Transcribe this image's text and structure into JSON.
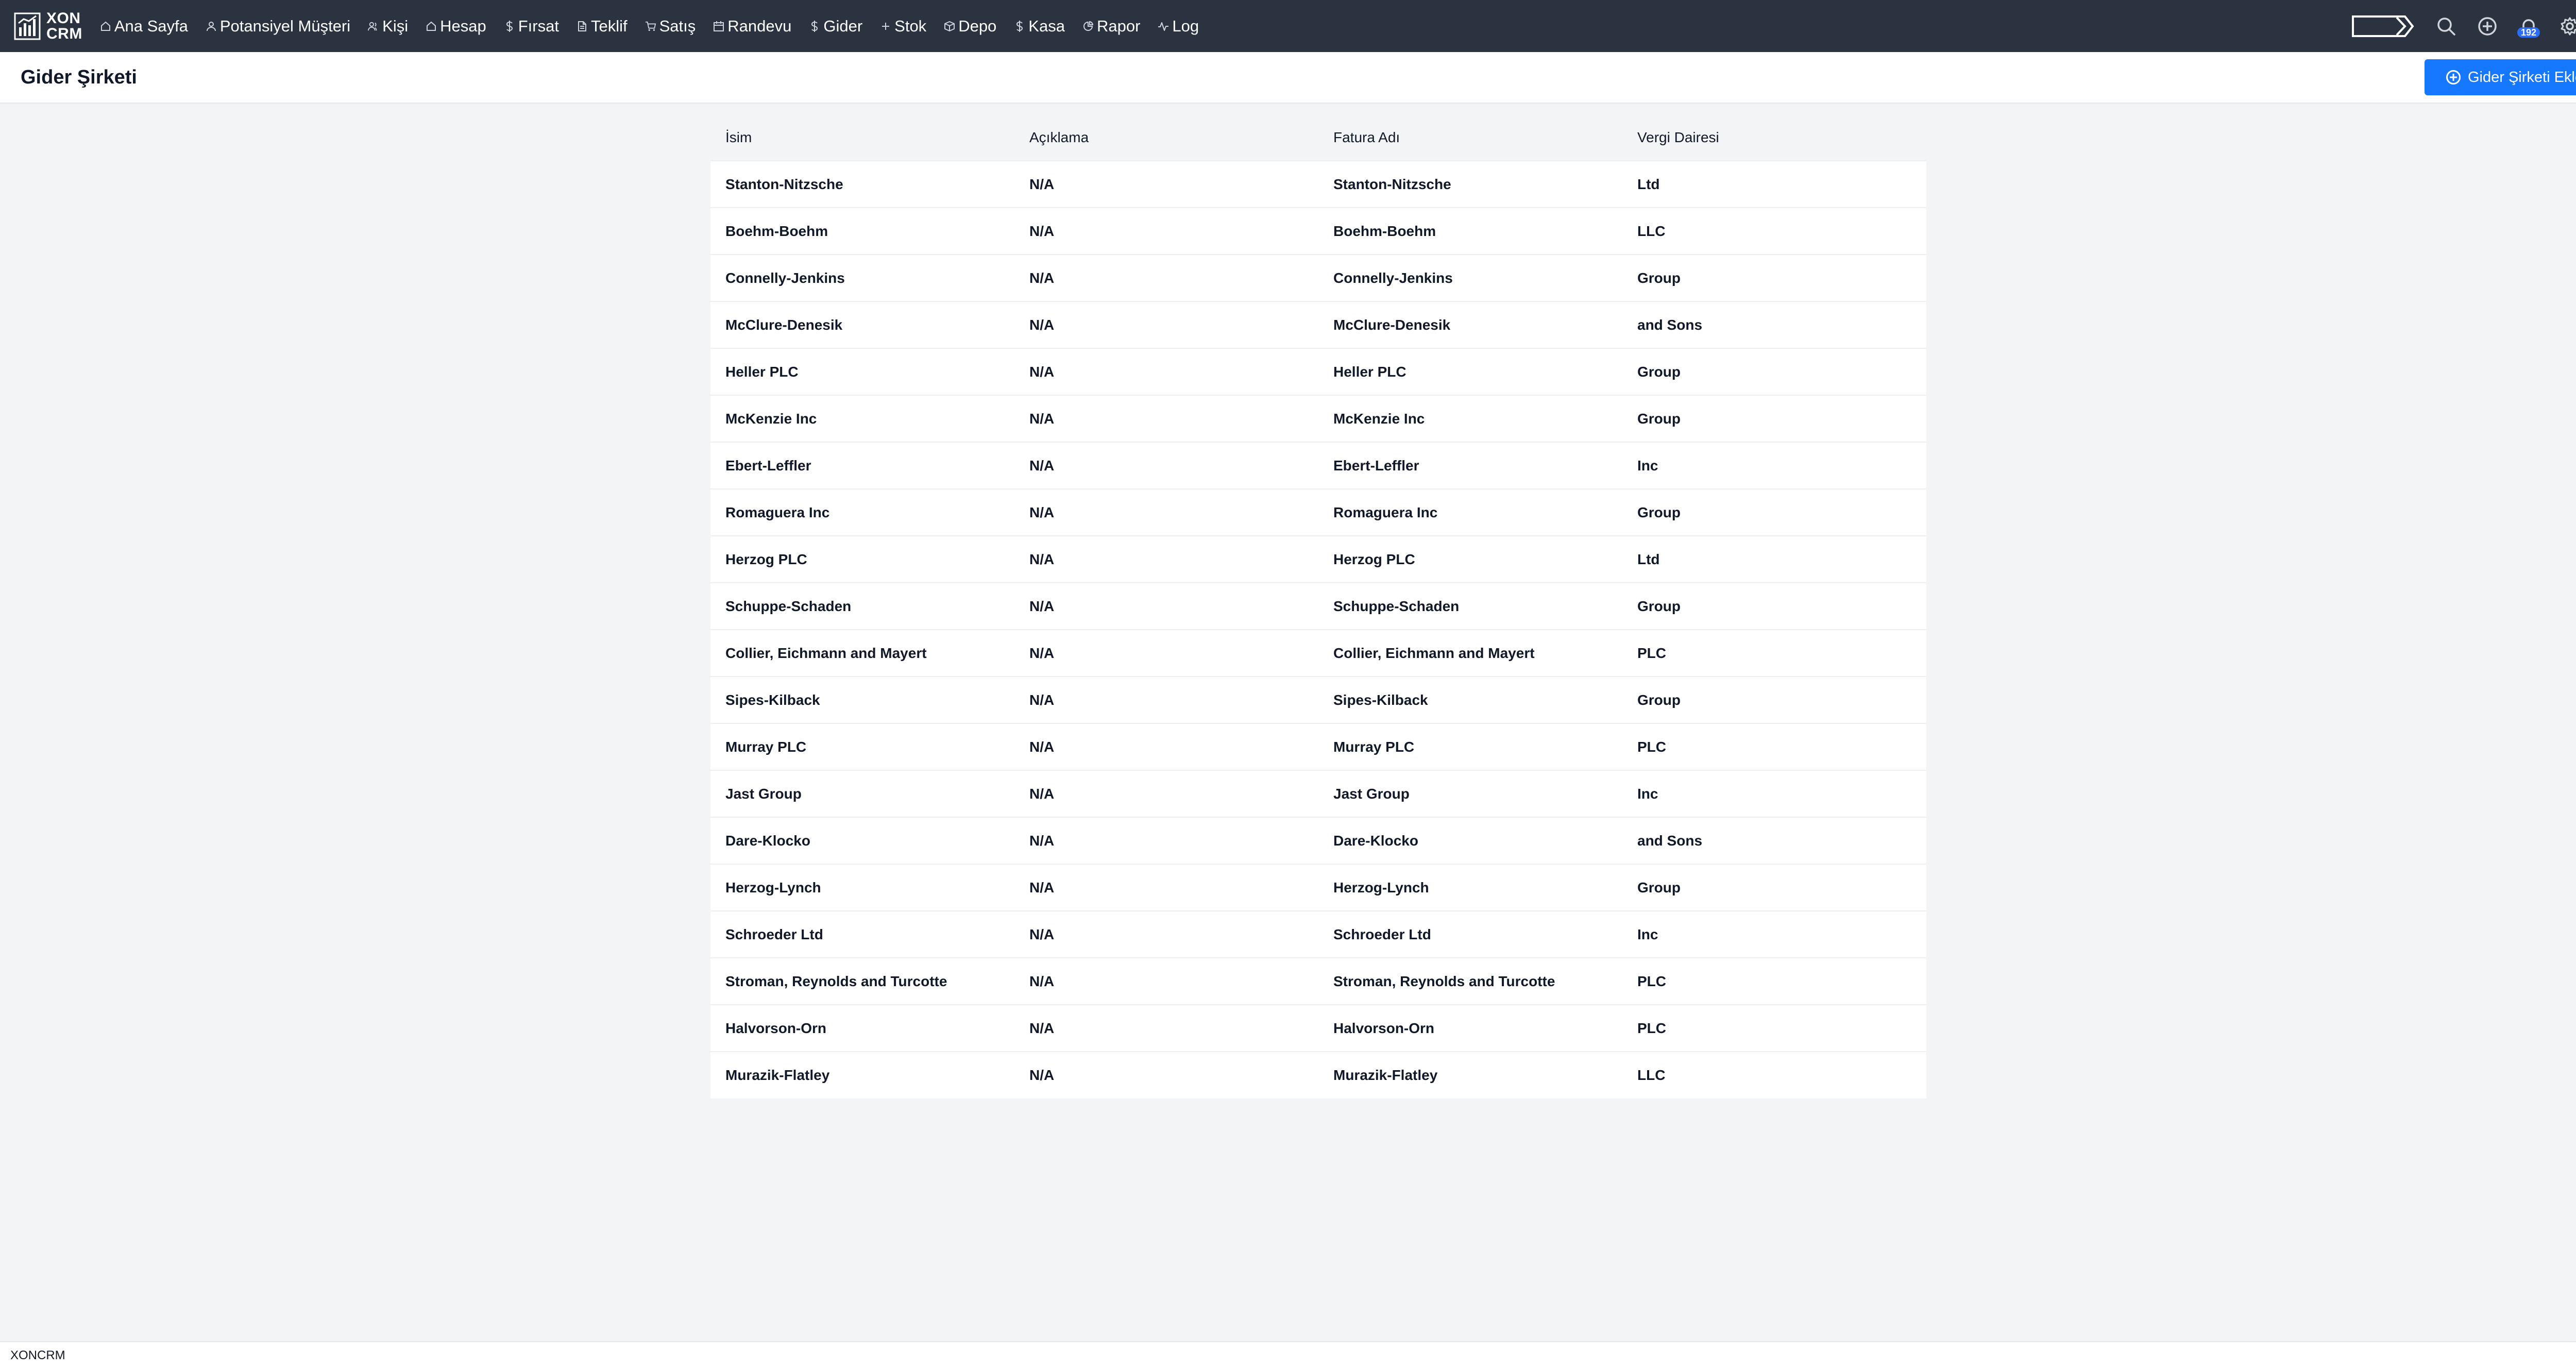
{
  "brand": {
    "line1": "XON",
    "line2": "CRM"
  },
  "nav": {
    "items": [
      {
        "label": "Ana Sayfa",
        "icon": "home-icon"
      },
      {
        "label": "Potansiyel Müşteri",
        "icon": "user-icon"
      },
      {
        "label": "Kişi",
        "icon": "users-icon"
      },
      {
        "label": "Hesap",
        "icon": "building-icon"
      },
      {
        "label": "Fırsat",
        "icon": "dollar-icon"
      },
      {
        "label": "Teklif",
        "icon": "document-icon"
      },
      {
        "label": "Satış",
        "icon": "cart-icon"
      },
      {
        "label": "Randevu",
        "icon": "calendar-icon"
      },
      {
        "label": "Gider",
        "icon": "dollar-icon"
      },
      {
        "label": "Stok",
        "icon": "plus-icon"
      },
      {
        "label": "Depo",
        "icon": "box-icon"
      },
      {
        "label": "Kasa",
        "icon": "dollar-icon"
      },
      {
        "label": "Rapor",
        "icon": "pie-chart-icon"
      },
      {
        "label": "Log",
        "icon": "activity-icon"
      }
    ],
    "notification_count": "192"
  },
  "header": {
    "title": "Gider Şirketi",
    "add_button_label": "Gider Şirketi Ekle"
  },
  "table": {
    "columns": [
      "İsim",
      "Açıklama",
      "Fatura Adı",
      "Vergi Dairesi"
    ],
    "rows": [
      [
        "Stanton-Nitzsche",
        "N/A",
        "Stanton-Nitzsche",
        "Ltd"
      ],
      [
        "Boehm-Boehm",
        "N/A",
        "Boehm-Boehm",
        "LLC"
      ],
      [
        "Connelly-Jenkins",
        "N/A",
        "Connelly-Jenkins",
        "Group"
      ],
      [
        "McClure-Denesik",
        "N/A",
        "McClure-Denesik",
        "and Sons"
      ],
      [
        "Heller PLC",
        "N/A",
        "Heller PLC",
        "Group"
      ],
      [
        "McKenzie Inc",
        "N/A",
        "McKenzie Inc",
        "Group"
      ],
      [
        "Ebert-Leffler",
        "N/A",
        "Ebert-Leffler",
        "Inc"
      ],
      [
        "Romaguera Inc",
        "N/A",
        "Romaguera Inc",
        "Group"
      ],
      [
        "Herzog PLC",
        "N/A",
        "Herzog PLC",
        "Ltd"
      ],
      [
        "Schuppe-Schaden",
        "N/A",
        "Schuppe-Schaden",
        "Group"
      ],
      [
        "Collier, Eichmann and Mayert",
        "N/A",
        "Collier, Eichmann and Mayert",
        "PLC"
      ],
      [
        "Sipes-Kilback",
        "N/A",
        "Sipes-Kilback",
        "Group"
      ],
      [
        "Murray PLC",
        "N/A",
        "Murray PLC",
        "PLC"
      ],
      [
        "Jast Group",
        "N/A",
        "Jast Group",
        "Inc"
      ],
      [
        "Dare-Klocko",
        "N/A",
        "Dare-Klocko",
        "and Sons"
      ],
      [
        "Herzog-Lynch",
        "N/A",
        "Herzog-Lynch",
        "Group"
      ],
      [
        "Schroeder Ltd",
        "N/A",
        "Schroeder Ltd",
        "Inc"
      ],
      [
        "Stroman, Reynolds and Turcotte",
        "N/A",
        "Stroman, Reynolds and Turcotte",
        "PLC"
      ],
      [
        "Halvorson-Orn",
        "N/A",
        "Halvorson-Orn",
        "PLC"
      ],
      [
        "Murazik-Flatley",
        "N/A",
        "Murazik-Flatley",
        "LLC"
      ]
    ]
  },
  "footer": {
    "text": "XONCRM"
  },
  "colors": {
    "navbar_bg": "#2b3240",
    "accent": "#1677ff",
    "page_bg": "#f3f4f6"
  }
}
